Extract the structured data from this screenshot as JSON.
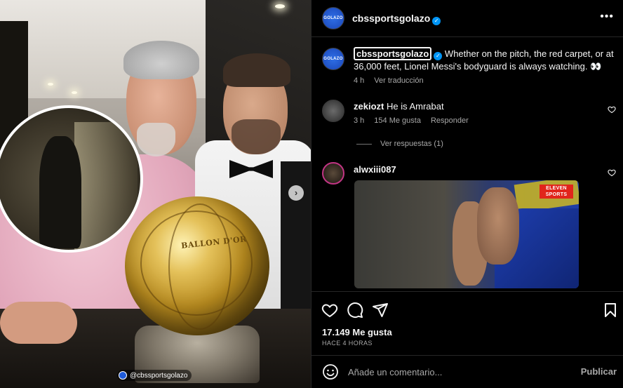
{
  "post": {
    "username": "cbssportsgolazo",
    "avatar_text": "GOLAZO",
    "caption_text": "Whether on the pitch, the red carpet, or at 36,000 feet, Lionel Messi's bodyguard is always watching. 👀",
    "caption_time": "4 h",
    "translate_label": "Ver traducción",
    "more_icon": "more-dots-icon"
  },
  "photo": {
    "watermark": "@cbssportsgolazo",
    "ball_text": "BALLON D'OR"
  },
  "comments": [
    {
      "username": "zekiozt",
      "text": "He is Amrabat",
      "time": "3 h",
      "likes": "154 Me gusta",
      "reply_label": "Responder",
      "view_replies": "Ver respuestas (1)"
    },
    {
      "username": "alwxiii087",
      "gif_badge": "ELEVEN SPORTS"
    }
  ],
  "actions": {
    "likes": "17.149 Me gusta",
    "time_ago": "HACE 4 HORAS"
  },
  "comment_box": {
    "placeholder": "Añade un comentario...",
    "publish_label": "Publicar"
  },
  "colors": {
    "verified": "#0095f6",
    "background": "#000000",
    "muted_text": "#a8a8a8"
  }
}
